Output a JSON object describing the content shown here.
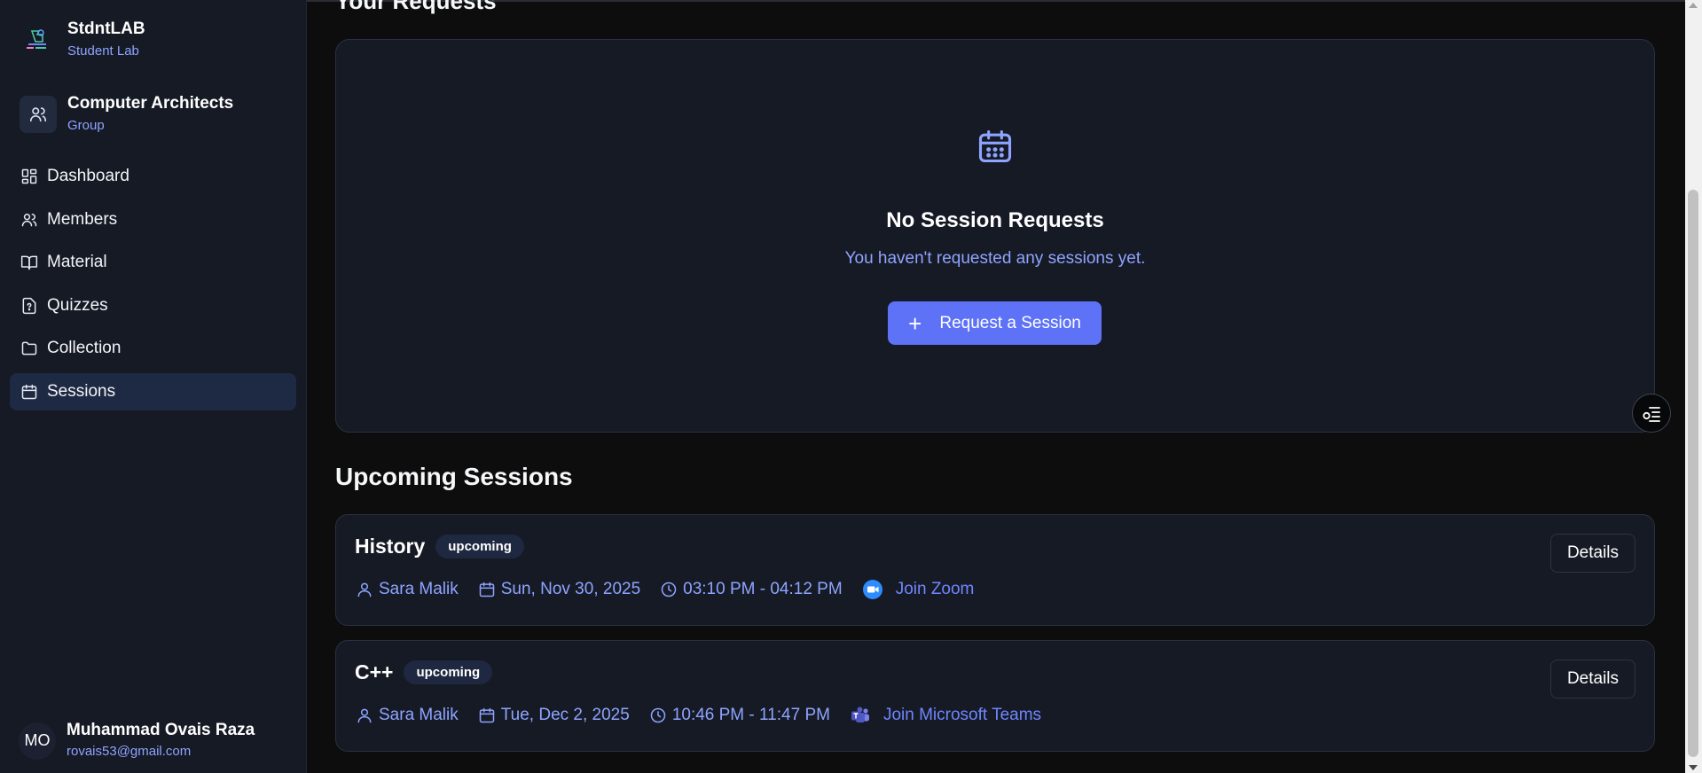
{
  "sidebar": {
    "brand": {
      "title": "StdntLAB",
      "subtitle": "Student Lab"
    },
    "group": {
      "name": "Computer Architects",
      "type": "Group",
      "icon": "users-icon"
    },
    "nav": [
      {
        "label": "Dashboard",
        "icon": "dashboard-icon"
      },
      {
        "label": "Members",
        "icon": "users-icon"
      },
      {
        "label": "Material",
        "icon": "book-icon"
      },
      {
        "label": "Quizzes",
        "icon": "quiz-icon"
      },
      {
        "label": "Collection",
        "icon": "folder-icon"
      },
      {
        "label": "Sessions",
        "icon": "calendar-icon",
        "active": true
      }
    ],
    "user": {
      "initials": "MO",
      "name": "Muhammad Ovais Raza",
      "email": "rovais53@gmail.com"
    }
  },
  "requests": {
    "heading": "Your Requests",
    "empty_title": "No Session Requests",
    "empty_text": "You haven't requested any sessions yet.",
    "button_label": "Request a Session"
  },
  "upcoming": {
    "heading": "Upcoming Sessions",
    "sessions": [
      {
        "title": "History",
        "status": "upcoming",
        "host": "Sara Malik",
        "date": "Sun, Nov 30, 2025",
        "time": "03:10 PM - 04:12 PM",
        "join_label": "Join Zoom",
        "platform_icon": "zoom-icon",
        "details_label": "Details"
      },
      {
        "title": "C++",
        "status": "upcoming",
        "host": "Sara Malik",
        "date": "Tue, Dec 2, 2025",
        "time": "10:46 PM - 11:47 PM",
        "join_label": "Join Microsoft Teams",
        "platform_icon": "teams-icon",
        "details_label": "Details"
      }
    ]
  },
  "colors": {
    "accent": "#5d72f7",
    "link": "#8ea4ff",
    "background": "#0d0d0e",
    "panel": "#161a25"
  }
}
